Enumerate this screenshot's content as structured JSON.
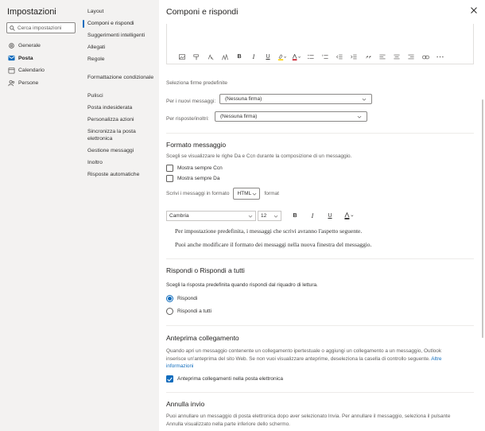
{
  "sidebar": {
    "title": "Impostazioni",
    "search_placeholder": "Cerca impostazioni",
    "items": [
      {
        "label": "Generale",
        "icon": "gear-icon"
      },
      {
        "label": "Posta",
        "icon": "mail-icon",
        "active": true
      },
      {
        "label": "Calendario",
        "icon": "calendar-icon"
      },
      {
        "label": "Persone",
        "icon": "people-icon"
      }
    ]
  },
  "subnav": {
    "group1": [
      "Layout",
      "Componi e rispondi",
      "Suggerimenti intelligenti",
      "Allegati",
      "Regole"
    ],
    "group2": [
      "Formattazione condizionale"
    ],
    "group3": [
      "Pulisci",
      "Posta indesiderata",
      "Personalizza azioni",
      "Sincronizza la posta elettronica",
      "Gestione messaggi",
      "Inoltro",
      "Risposte automatiche"
    ]
  },
  "main": {
    "title": "Componi e rispondi",
    "signature": {
      "heading": "Seleziona firme predefinite",
      "new_label": "Per i nuovi messaggi:",
      "new_value": "(Nessuna firma)",
      "reply_label": "Per risposte/inoltri:",
      "reply_value": "(Nessuna firma)"
    },
    "format": {
      "title": "Formato messaggio",
      "desc": "Scegli se visualizzare le righe Da e Ccn durante la composizione di un messaggio.",
      "cb_ccn": "Mostra sempre Ccn",
      "cb_da": "Mostra sempre Da",
      "compose_label": "Scrivi i messaggi in formato",
      "compose_value": "HTML",
      "compose_suffix": "format",
      "font_name": "Cambria",
      "font_size": "12",
      "preview_1": "Per impostazione predefinita, i messaggi che scrivi avranno l'aspetto seguente.",
      "preview_2": "Puoi anche modificare il formato dei messaggi nella nuova finestra del messaggio."
    },
    "reply": {
      "title": "Rispondi o Rispondi a tutti",
      "desc": "Scegli la risposta predefinita quando rispondi dal riquadro di lettura.",
      "opt1": "Rispondi",
      "opt2": "Rispondi a tutti"
    },
    "preview_links": {
      "title": "Anteprima collegamento",
      "desc_1": "Quando apri un messaggio contenente un collegamento ipertestuale o aggiungi un collegamento a un messaggio, Outlook",
      "desc_2": "inserisce un'anteprima del sito Web. Se non vuoi visualizzare anteprime, deseleziona la casella di controllo seguente.",
      "link_a": "Altre",
      "link_b": "informazioni",
      "cb": "Anteprima collegamenti nella posta elettronica"
    },
    "undo": {
      "title": "Annulla invio",
      "desc_1": "Puoi annullare un messaggio di posta elettronica dopo aver selezionato Invia. Per annullare il messaggio, seleziona il pulsante",
      "desc_2": "Annulla visualizzato nella parte inferiore dello schermo."
    }
  },
  "colors": {
    "accent": "#0f6cbd",
    "highlight": "#ffd000",
    "font_color": "#c50f1f"
  }
}
